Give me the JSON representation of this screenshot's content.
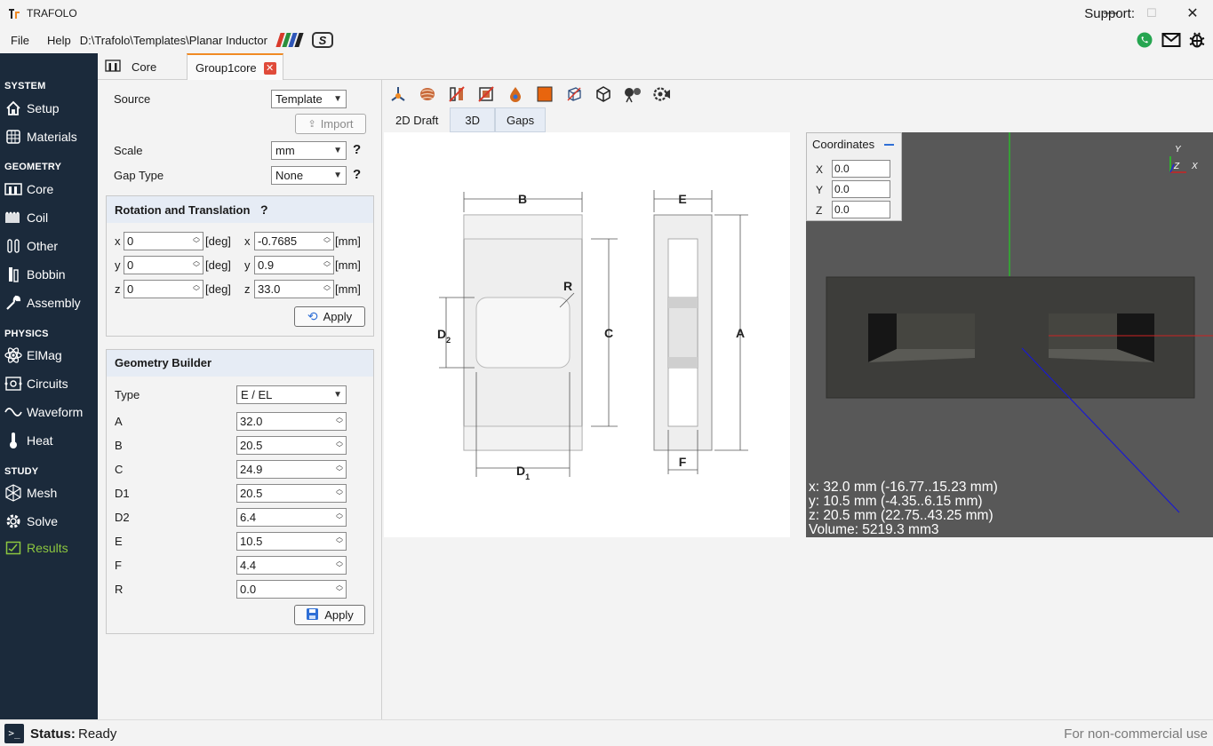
{
  "window": {
    "title": "TRAFOLO",
    "minimize": "—",
    "maximize": "☐",
    "close": "✕"
  },
  "menu": {
    "file": "File",
    "help": "Help",
    "path": "D:\\Trafolo\\Templates\\Planar Inductor"
  },
  "support": {
    "label": "Support:"
  },
  "sidebar": {
    "system": "SYSTEM",
    "geometry": "GEOMETRY",
    "physics": "PHYSICS",
    "study": "STUDY",
    "items": {
      "setup": "Setup",
      "materials": "Materials",
      "core": "Core",
      "coil": "Coil",
      "other": "Other",
      "bobbin": "Bobbin",
      "assembly": "Assembly",
      "elmag": "ElMag",
      "circuits": "Circuits",
      "waveform": "Waveform",
      "heat": "Heat",
      "mesh": "Mesh",
      "solve": "Solve",
      "results": "Results"
    }
  },
  "tabs": {
    "core": "Core",
    "group1core": "Group1core"
  },
  "settings": {
    "source_label": "Source",
    "source_value": "Template",
    "import_label": "Import",
    "scale_label": "Scale",
    "scale_value": "mm",
    "gap_label": "Gap Type",
    "gap_value": "None",
    "help": "?"
  },
  "rotation": {
    "title": "Rotation and Translation",
    "rows": [
      {
        "axis": "x",
        "rot": "0",
        "unit_rot": "[deg]",
        "taxis": "x",
        "trans": "-0.7685",
        "unit_trans": "[mm]"
      },
      {
        "axis": "y",
        "rot": "0",
        "unit_rot": "[deg]",
        "taxis": "y",
        "trans": "0.9",
        "unit_trans": "[mm]"
      },
      {
        "axis": "z",
        "rot": "0",
        "unit_rot": "[deg]",
        "taxis": "z",
        "trans": "33.0",
        "unit_trans": "[mm]"
      }
    ],
    "apply": "Apply"
  },
  "builder": {
    "title": "Geometry Builder",
    "type_label": "Type",
    "type_value": "E / EL",
    "params": [
      {
        "name": "A",
        "value": "32.0"
      },
      {
        "name": "B",
        "value": "20.5"
      },
      {
        "name": "C",
        "value": "24.9"
      },
      {
        "name": "D1",
        "value": "20.5"
      },
      {
        "name": "D2",
        "value": "6.4"
      },
      {
        "name": "E",
        "value": "10.5"
      },
      {
        "name": "F",
        "value": "4.4"
      },
      {
        "name": "R",
        "value": "0.0"
      }
    ],
    "apply": "Apply"
  },
  "view_tabs": {
    "draft": "2D Draft",
    "three_d": "3D",
    "gaps": "Gaps"
  },
  "drawing": {
    "B": "B",
    "E": "E",
    "R": "R",
    "C": "C",
    "A": "A",
    "D": "D",
    "sub2": "2",
    "sub1": "1",
    "F": "F"
  },
  "coordinates": {
    "title": "Coordinates",
    "x_label": "X",
    "x": "0.0",
    "y_label": "Y",
    "y": "0.0",
    "z_label": "Z",
    "z": "0.0"
  },
  "axes": {
    "y": "Y",
    "z": "Z",
    "x": "X"
  },
  "viewport_info": {
    "x": "x: 32.0 mm (-16.77..15.23 mm)",
    "y": "y: 10.5 mm (-4.35..6.15 mm)",
    "z": "z: 20.5 mm (22.75..43.25 mm)",
    "volume": "Volume: 5219.3 mm3"
  },
  "status": {
    "label": "Status:",
    "value": "Ready",
    "license": "For non-commercial use",
    "icon": ">_"
  },
  "colors": {
    "sidebar": "#1b2a3b",
    "active": "#8cc63f",
    "accent": "#f08a24",
    "close": "#e04b3a",
    "viewport": "#585858"
  }
}
